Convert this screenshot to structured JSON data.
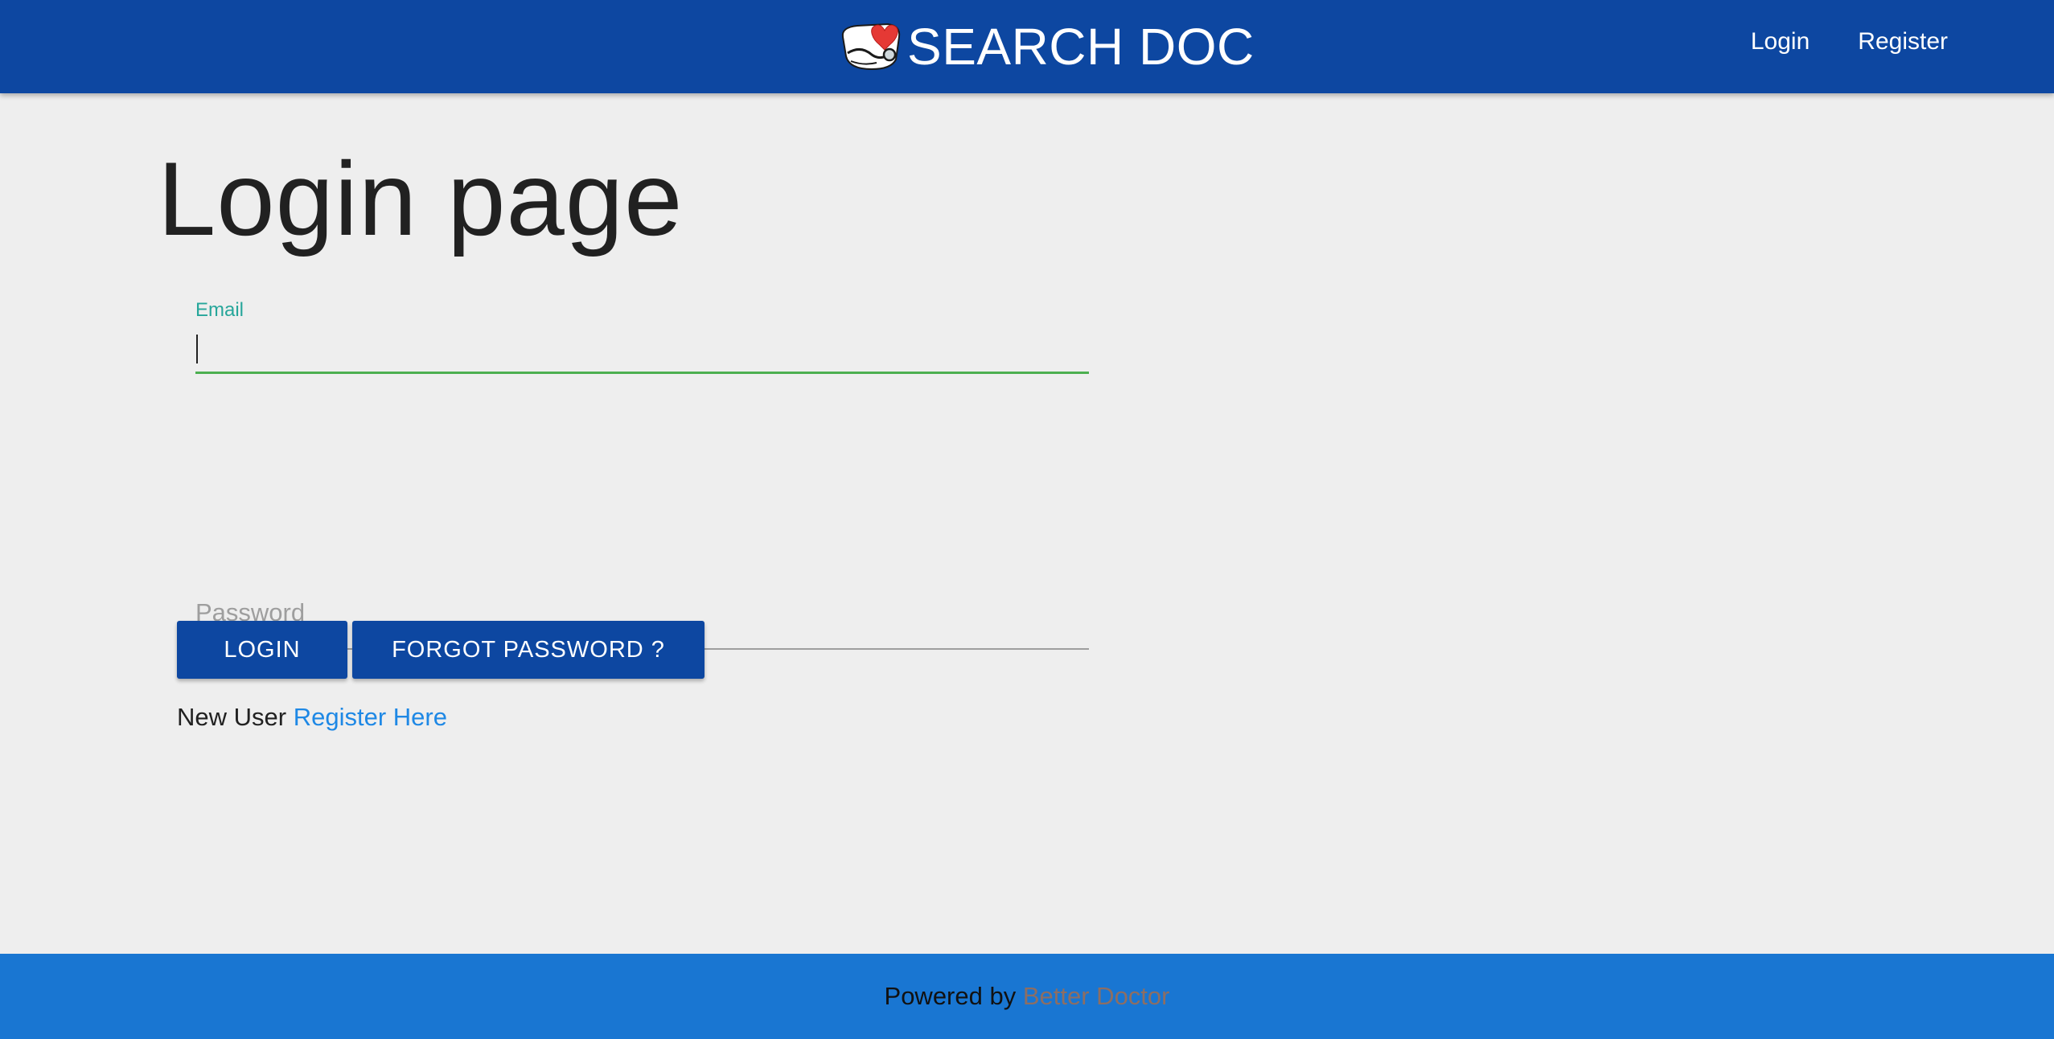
{
  "header": {
    "brand_text": "SEARCH DOC",
    "logo_icon": "heart-stethoscope-logo",
    "nav": [
      {
        "label": "Login"
      },
      {
        "label": "Register"
      }
    ],
    "background_color": "#0d47a1"
  },
  "page": {
    "title": "Login page"
  },
  "form": {
    "email": {
      "label": "Email",
      "value": "",
      "focused": true
    },
    "password": {
      "placeholder": "Password",
      "value": ""
    },
    "login_button": "LOGIN",
    "forgot_button": "FORGOT PASSWORD ?",
    "signup_prefix": "New User",
    "signup_link": "Register Here"
  },
  "footer": {
    "prefix": "Powered by",
    "link": "Better Doctor",
    "background_color": "#1976d2"
  },
  "colors": {
    "primary": "#0d47a1",
    "focus_label": "#26a69a",
    "focus_underline": "#4caf50",
    "link": "#1e88e5",
    "footer_link": "#8d6e63"
  }
}
